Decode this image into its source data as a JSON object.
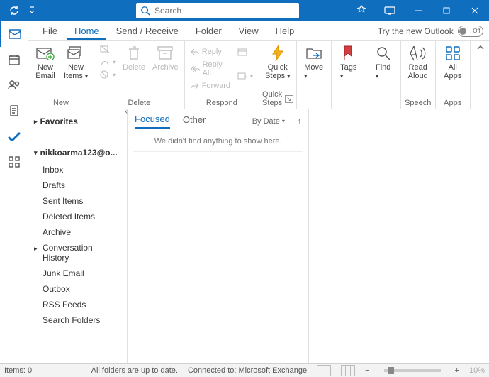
{
  "titlebar": {
    "search_placeholder": "Search"
  },
  "menu": {
    "file": "File",
    "home": "Home",
    "send_receive": "Send / Receive",
    "folder": "Folder",
    "view": "View",
    "help": "Help",
    "try_new": "Try the new Outlook",
    "toggle_state": "Off"
  },
  "ribbon": {
    "new_email": "New\nEmail",
    "new_items": "New\nItems",
    "new_group": "New",
    "delete": "Delete",
    "archive": "Archive",
    "delete_group": "Delete",
    "reply": "Reply",
    "reply_all": "Reply All",
    "forward": "Forward",
    "respond_group": "Respond",
    "quick_steps": "Quick\nSteps",
    "quick_steps_group": "Quick Steps",
    "move": "Move",
    "tags": "Tags",
    "find": "Find",
    "read_aloud": "Read\nAloud",
    "speech_group": "Speech",
    "all_apps": "All\nApps",
    "apps_group": "Apps"
  },
  "folders": {
    "favorites": "Favorites",
    "account": "nikkoarma123@o...",
    "inbox": "Inbox",
    "drafts": "Drafts",
    "sent": "Sent Items",
    "deleted": "Deleted Items",
    "archive": "Archive",
    "conversation_history": "Conversation History",
    "junk": "Junk Email",
    "outbox": "Outbox",
    "rss": "RSS Feeds",
    "search_folders": "Search Folders"
  },
  "list": {
    "focused": "Focused",
    "other": "Other",
    "sort": "By Date",
    "empty": "We didn't find anything to show here."
  },
  "status": {
    "items": "Items: 0",
    "sync": "All folders are up to date.",
    "connected": "Connected to: Microsoft Exchange",
    "zoom": "10%"
  }
}
